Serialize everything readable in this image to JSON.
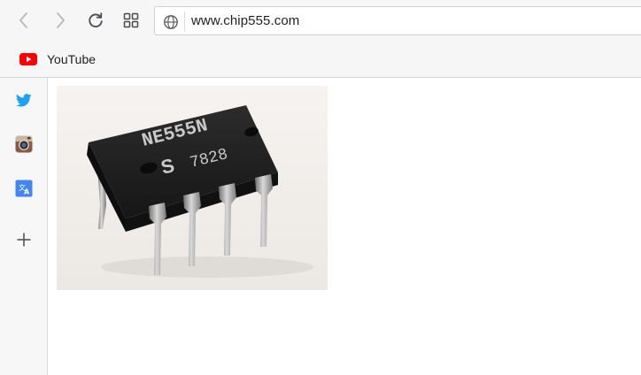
{
  "toolbar": {
    "back_icon": "chevron-left-icon",
    "forward_icon": "chevron-right-icon",
    "reload_icon": "reload-icon",
    "tabs_icon": "tab-grid-icon"
  },
  "address_bar": {
    "url": "www.chip555.com",
    "site_icon": "globe-icon"
  },
  "bookmarks": [
    {
      "label": "YouTube",
      "icon": "youtube-icon",
      "color": "#ff0000"
    }
  ],
  "sidebar": {
    "items": [
      {
        "name": "twitter",
        "icon": "twitter-icon",
        "color": "#1da1f2"
      },
      {
        "name": "instagram",
        "icon": "instagram-icon",
        "color": "#8a5a44"
      },
      {
        "name": "translate",
        "icon": "translate-icon",
        "color": "#4285f4"
      },
      {
        "name": "add",
        "icon": "plus-icon",
        "color": "#555555"
      }
    ]
  },
  "content": {
    "image": {
      "subject": "NE555N timer IC chip (DIP-8 package)",
      "markings": [
        "NE555N",
        "S 7828"
      ]
    }
  },
  "colors": {
    "chrome_background": "#f6f6f7",
    "page_background": "#ffffff",
    "chip_body": "#1c1c1c",
    "chip_text": "#c9c9c9"
  }
}
